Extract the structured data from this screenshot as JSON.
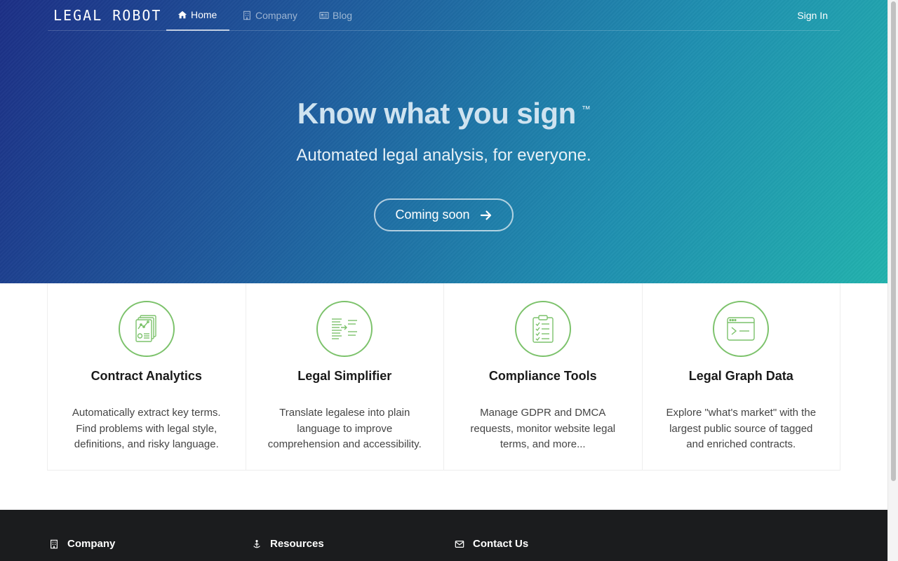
{
  "nav": {
    "brand": "LEGAL ROBOT",
    "items": [
      {
        "label": "Home",
        "icon": "home-icon",
        "active": true
      },
      {
        "label": "Company",
        "icon": "building-icon",
        "active": false
      },
      {
        "label": "Blog",
        "icon": "newspaper-icon",
        "active": false
      }
    ],
    "sign_in": "Sign In"
  },
  "hero": {
    "title": "Know what you sign",
    "trademark": "™",
    "subtitle": "Automated legal analysis, for everyone.",
    "cta_label": "Coming soon"
  },
  "features": [
    {
      "title": "Contract Analytics",
      "icon": "document-chart-icon",
      "text": "Automatically extract key terms. Find problems with legal style, definitions, and risky language."
    },
    {
      "title": "Legal Simplifier",
      "icon": "simplify-text-icon",
      "text": "Translate legalese into plain language to improve comprehension and accessibility."
    },
    {
      "title": "Compliance Tools",
      "icon": "clipboard-checklist-icon",
      "text": "Manage GDPR and DMCA requests, monitor website legal terms, and more..."
    },
    {
      "title": "Legal Graph Data",
      "icon": "terminal-window-icon",
      "text": "Explore \"what's market\" with the largest public source of tagged and enriched contracts."
    }
  ],
  "footer": {
    "columns": [
      {
        "label": "Company",
        "icon": "building-icon"
      },
      {
        "label": "Resources",
        "icon": "anchor-person-icon"
      },
      {
        "label": "Contact Us",
        "icon": "envelope-icon"
      }
    ]
  },
  "colors": {
    "accent_green": "#7cc26b",
    "footer_bg": "#1b1c1e"
  }
}
